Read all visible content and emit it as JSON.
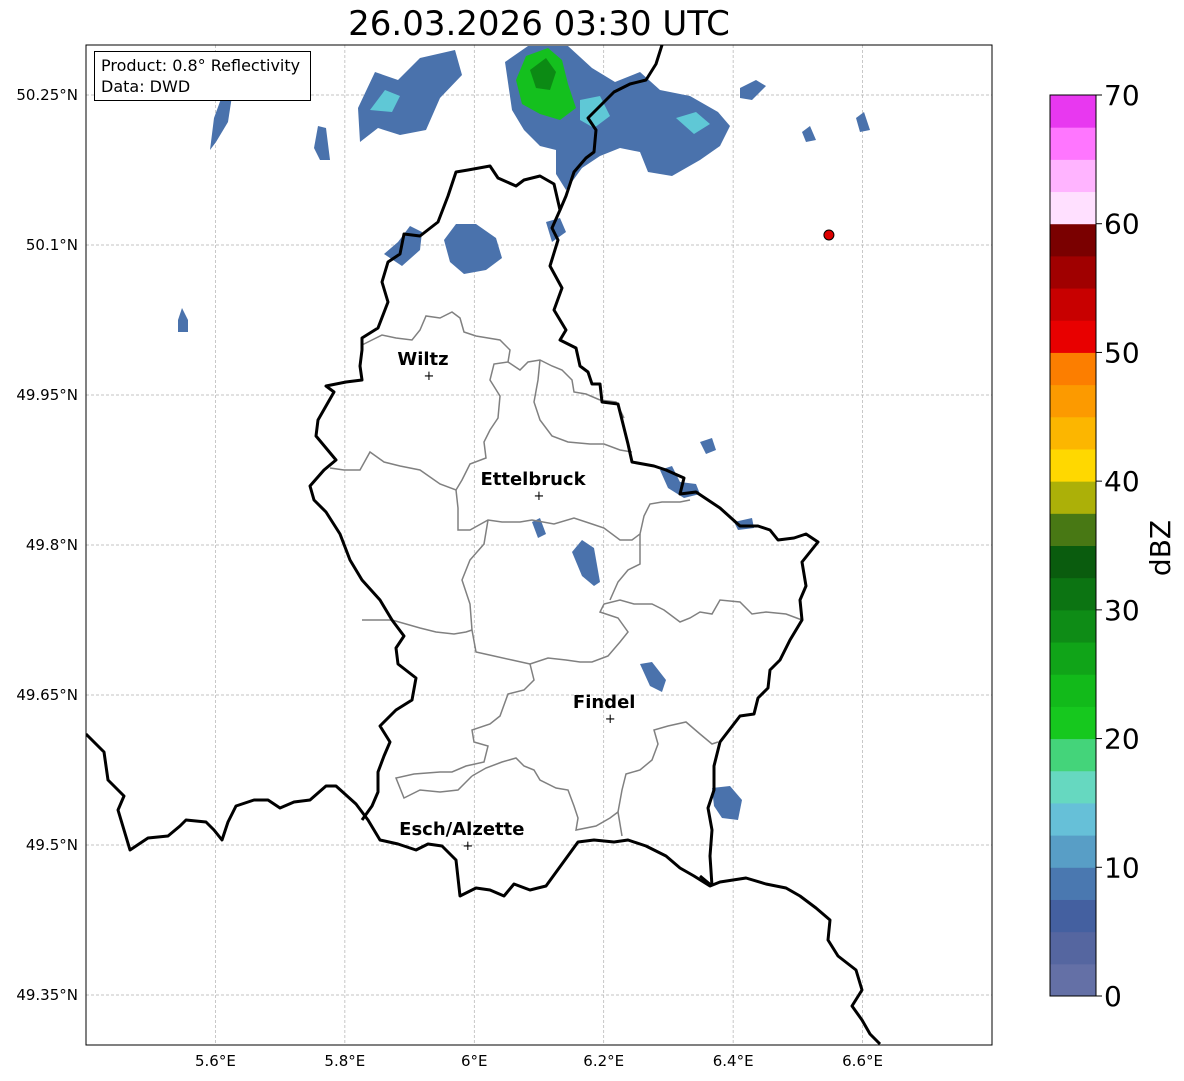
{
  "title": "26.03.2026 03:30 UTC",
  "info": {
    "product": "Product: 0.8° Reflectivity",
    "data": "Data: DWD"
  },
  "map": {
    "lon_range": [
      5.4,
      6.8
    ],
    "lat_range": [
      49.3,
      50.3
    ],
    "lon_ticks": [
      {
        "v": 5.6,
        "label": "5.6°E"
      },
      {
        "v": 5.8,
        "label": "5.8°E"
      },
      {
        "v": 6.0,
        "label": "6°E"
      },
      {
        "v": 6.2,
        "label": "6.2°E"
      },
      {
        "v": 6.4,
        "label": "6.4°E"
      },
      {
        "v": 6.6,
        "label": "6.6°E"
      }
    ],
    "lat_ticks": [
      {
        "v": 50.25,
        "label": "50.25°N"
      },
      {
        "v": 50.1,
        "label": "50.1°N"
      },
      {
        "v": 49.95,
        "label": "49.95°N"
      },
      {
        "v": 49.8,
        "label": "49.8°N"
      },
      {
        "v": 49.65,
        "label": "49.65°N"
      },
      {
        "v": 49.5,
        "label": "49.5°N"
      },
      {
        "v": 49.35,
        "label": "49.35°N"
      }
    ],
    "cities": [
      {
        "name": "Wiltz",
        "lon": 5.93,
        "lat": 49.97
      },
      {
        "name": "Ettelbruck",
        "lon": 6.1,
        "lat": 49.85
      },
      {
        "name": "Findel",
        "lon": 6.21,
        "lat": 49.627
      },
      {
        "name": "Esch/Alzette",
        "lon": 5.99,
        "lat": 49.5
      }
    ],
    "radar_site": {
      "lon": 6.548,
      "lat": 50.11,
      "color": "#dd0000"
    }
  },
  "colorbar": {
    "label": "dBZ",
    "min": 0,
    "max": 70,
    "step": 2.5,
    "ticks": [
      0,
      10,
      20,
      30,
      40,
      50,
      60,
      70
    ],
    "colors": [
      "#6470a6",
      "#5566a0",
      "#4460a0",
      "#4a78b0",
      "#589ec6",
      "#66c0d8",
      "#66d8c0",
      "#44d47a",
      "#16c81e",
      "#12ba1a",
      "#10a418",
      "#0e8c16",
      "#0c7412",
      "#0a5c0e",
      "#487814",
      "#acb008",
      "#ffd800",
      "#fcb600",
      "#fc9a00",
      "#fc7e00",
      "#e80000",
      "#c80000",
      "#a00000",
      "#7a0000",
      "#ffe0ff",
      "#ffb4ff",
      "#ff76ff",
      "#e838f0"
    ]
  }
}
